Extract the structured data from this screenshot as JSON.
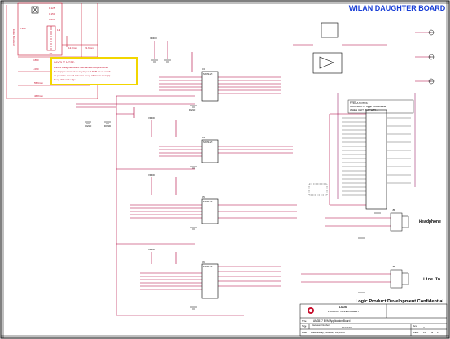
{
  "header": {
    "title": "WILAN DAUGHTER BOARD"
  },
  "mechanical": {
    "dimensions": [
      "1.125",
      "0.150",
      "0.500",
      "0.880",
      "1.060",
      "0.300",
      "1.3",
      "1.8 mm",
      "55.9mm",
      "46.8mm",
      "12.0mm",
      "21.6mm"
    ],
    "side_label": "Edge Mounted",
    "connector_ref": "J11"
  },
  "layout_note": {
    "lines": [
      "LAYOUT NOTE:",
      "WiLAN Daughter Board Mechanical Requirements",
      "No Copper allowed on any layer of PCB for as much",
      "as possible around Antenna Keep. Minimize trace(s)",
      "Keep all board edge"
    ]
  },
  "notes_box": {
    "lines": [
      "TI 501A NOTES:",
      "MMC/SDIO IS ONLY AVAILABLE",
      "WHEN UNIT IS AT WIFI..."
    ]
  },
  "chips": [
    {
      "ref": "U3",
      "part": "SN74LVC"
    },
    {
      "ref": "U4",
      "part": "SN74LVC"
    },
    {
      "ref": "U5",
      "part": "SN74LVC"
    },
    {
      "ref": "U6",
      "part": "SN74LVC"
    },
    {
      "ref": "U7",
      "part": "CONN"
    }
  ],
  "gnd_label": "DGND",
  "vcc_label": "VDDIO",
  "jacks": [
    {
      "ref": "J5",
      "label": "Headphone"
    },
    {
      "ref": "J6",
      "label": "Line In"
    }
  ],
  "title_block": {
    "confidential": "Logic Product Development Confidential",
    "company": "LOGIC",
    "department": "PRODUCT DEVELOPMENT",
    "title_label": "Title",
    "title_value": "AM3517 EVM Application Board",
    "size_label": "Size",
    "size_value": "C",
    "doc_label": "Document Number",
    "doc_value": "1012133",
    "rev_label": "Rev",
    "rev_value": "A",
    "date_label": "Date",
    "date_value": "Wednesday, February 24, 2010",
    "sheet_label": "Sheet",
    "sheet_value": "15",
    "of_label": "of",
    "of_value": "17"
  }
}
